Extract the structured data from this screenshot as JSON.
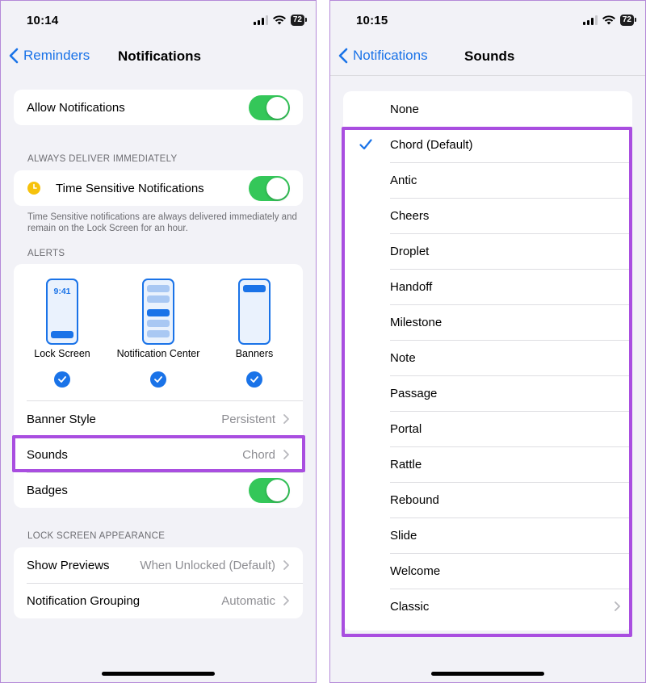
{
  "left": {
    "status": {
      "time": "10:14",
      "battery": "72"
    },
    "nav": {
      "back_label": "Reminders",
      "title": "Notifications"
    },
    "allow_notifications": {
      "label": "Allow Notifications",
      "enabled": true
    },
    "deliver_header": "ALWAYS DELIVER IMMEDIATELY",
    "time_sensitive": {
      "label": "Time Sensitive Notifications",
      "enabled": true
    },
    "time_sensitive_footnote": "Time Sensitive notifications are always delivered immediately and remain on the Lock Screen for an hour.",
    "alerts_header": "ALERTS",
    "alert_styles": [
      {
        "label": "Lock Screen",
        "checked": true,
        "clock": "9:41"
      },
      {
        "label": "Notification Center",
        "checked": true
      },
      {
        "label": "Banners",
        "checked": true
      }
    ],
    "banner_style": {
      "label": "Banner Style",
      "value": "Persistent"
    },
    "sounds": {
      "label": "Sounds",
      "value": "Chord"
    },
    "badges": {
      "label": "Badges",
      "enabled": true
    },
    "lock_screen_header": "LOCK SCREEN APPEARANCE",
    "show_previews": {
      "label": "Show Previews",
      "value": "When Unlocked (Default)"
    },
    "grouping": {
      "label": "Notification Grouping",
      "value": "Automatic"
    }
  },
  "right": {
    "status": {
      "time": "10:15",
      "battery": "72"
    },
    "nav": {
      "back_label": "Notifications",
      "title": "Sounds"
    },
    "sounds": [
      {
        "label": "None",
        "selected": false
      },
      {
        "label": "Chord (Default)",
        "selected": true
      },
      {
        "label": "Antic",
        "selected": false
      },
      {
        "label": "Cheers",
        "selected": false
      },
      {
        "label": "Droplet",
        "selected": false
      },
      {
        "label": "Handoff",
        "selected": false
      },
      {
        "label": "Milestone",
        "selected": false
      },
      {
        "label": "Note",
        "selected": false
      },
      {
        "label": "Passage",
        "selected": false
      },
      {
        "label": "Portal",
        "selected": false
      },
      {
        "label": "Rattle",
        "selected": false
      },
      {
        "label": "Rebound",
        "selected": false
      },
      {
        "label": "Slide",
        "selected": false
      },
      {
        "label": "Welcome",
        "selected": false
      },
      {
        "label": "Classic",
        "selected": false,
        "has_submenu": true
      }
    ]
  },
  "colors": {
    "accent": "#1a73e8",
    "toggle_on": "#34c759",
    "highlight": "#a94ee0",
    "background": "#f2f2f7"
  },
  "icons": [
    "chevron-left-icon",
    "chevron-right-icon",
    "checkmark-icon",
    "clock-icon",
    "signal-icon",
    "wifi-icon",
    "battery-icon"
  ]
}
